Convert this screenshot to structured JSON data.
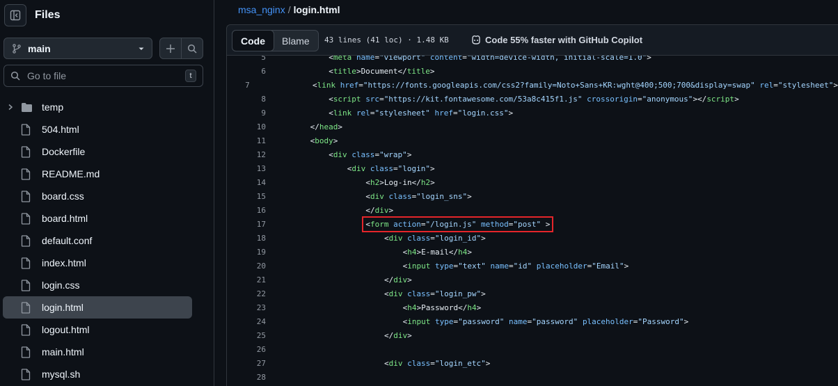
{
  "sidebar": {
    "title": "Files",
    "branch": "main",
    "search_placeholder": "Go to file",
    "search_shortcut": "t",
    "items": [
      {
        "name": "temp",
        "type": "folder"
      },
      {
        "name": "504.html",
        "type": "file"
      },
      {
        "name": "Dockerfile",
        "type": "file"
      },
      {
        "name": "README.md",
        "type": "file"
      },
      {
        "name": "board.css",
        "type": "file"
      },
      {
        "name": "board.html",
        "type": "file"
      },
      {
        "name": "default.conf",
        "type": "file"
      },
      {
        "name": "index.html",
        "type": "file"
      },
      {
        "name": "login.css",
        "type": "file"
      },
      {
        "name": "login.html",
        "type": "file",
        "active": true
      },
      {
        "name": "logout.html",
        "type": "file"
      },
      {
        "name": "main.html",
        "type": "file"
      },
      {
        "name": "mysql.sh",
        "type": "file"
      }
    ]
  },
  "breadcrumb": {
    "repo": "msa_nginx",
    "separator": "/",
    "file": "login.html"
  },
  "file_header": {
    "tab_code": "Code",
    "tab_blame": "Blame",
    "meta": "43 lines (41 loc) · 1.48 KB",
    "copilot": "Code 55% faster with GitHub Copilot"
  },
  "code_lines": [
    {
      "n": "5",
      "indent": 8,
      "tokens": [
        [
          "punc",
          "<"
        ],
        [
          "tag",
          "meta"
        ],
        [
          "punc",
          " "
        ],
        [
          "attr",
          "name"
        ],
        [
          "punc",
          "="
        ],
        [
          "str",
          "\"viewport\""
        ],
        [
          "punc",
          " "
        ],
        [
          "attr",
          "content"
        ],
        [
          "punc",
          "="
        ],
        [
          "str",
          "\"width=device-width, initial-scale=1.0\""
        ],
        [
          "punc",
          ">"
        ]
      ]
    },
    {
      "n": "6",
      "indent": 8,
      "tokens": [
        [
          "punc",
          "<"
        ],
        [
          "tag",
          "title"
        ],
        [
          "punc",
          ">"
        ],
        [
          "text",
          "Document"
        ],
        [
          "punc",
          "</"
        ],
        [
          "tag",
          "title"
        ],
        [
          "punc",
          ">"
        ]
      ]
    },
    {
      "n": "7",
      "indent": 8,
      "tokens": [
        [
          "punc",
          "<"
        ],
        [
          "tag",
          "link"
        ],
        [
          "punc",
          " "
        ],
        [
          "attr",
          "href"
        ],
        [
          "punc",
          "="
        ],
        [
          "str",
          "\"https://fonts.googleapis.com/css2?family=Noto+Sans+KR:wght@400;500;700&display=swap\""
        ],
        [
          "punc",
          " "
        ],
        [
          "attr",
          "rel"
        ],
        [
          "punc",
          "="
        ],
        [
          "str",
          "\"stylesheet\""
        ],
        [
          "punc",
          ">"
        ]
      ]
    },
    {
      "n": "8",
      "indent": 8,
      "tokens": [
        [
          "punc",
          "<"
        ],
        [
          "tag",
          "script"
        ],
        [
          "punc",
          " "
        ],
        [
          "attr",
          "src"
        ],
        [
          "punc",
          "="
        ],
        [
          "str",
          "\"https://kit.fontawesome.com/53a8c415f1.js\""
        ],
        [
          "punc",
          " "
        ],
        [
          "attr",
          "crossorigin"
        ],
        [
          "punc",
          "="
        ],
        [
          "str",
          "\"anonymous\""
        ],
        [
          "punc",
          "></"
        ],
        [
          "tag",
          "script"
        ],
        [
          "punc",
          ">"
        ]
      ]
    },
    {
      "n": "9",
      "indent": 8,
      "tokens": [
        [
          "punc",
          "<"
        ],
        [
          "tag",
          "link"
        ],
        [
          "punc",
          " "
        ],
        [
          "attr",
          "rel"
        ],
        [
          "punc",
          "="
        ],
        [
          "str",
          "\"stylesheet\""
        ],
        [
          "punc",
          " "
        ],
        [
          "attr",
          "href"
        ],
        [
          "punc",
          "="
        ],
        [
          "str",
          "\"login.css\""
        ],
        [
          "punc",
          ">"
        ]
      ]
    },
    {
      "n": "10",
      "indent": 4,
      "tokens": [
        [
          "punc",
          "</"
        ],
        [
          "tag",
          "head"
        ],
        [
          "punc",
          ">"
        ]
      ]
    },
    {
      "n": "11",
      "indent": 4,
      "tokens": [
        [
          "punc",
          "<"
        ],
        [
          "tag",
          "body"
        ],
        [
          "punc",
          ">"
        ]
      ]
    },
    {
      "n": "12",
      "indent": 8,
      "tokens": [
        [
          "punc",
          "<"
        ],
        [
          "tag",
          "div"
        ],
        [
          "punc",
          " "
        ],
        [
          "attr",
          "class"
        ],
        [
          "punc",
          "="
        ],
        [
          "str",
          "\"wrap\""
        ],
        [
          "punc",
          ">"
        ]
      ]
    },
    {
      "n": "13",
      "indent": 12,
      "tokens": [
        [
          "punc",
          "<"
        ],
        [
          "tag",
          "div"
        ],
        [
          "punc",
          " "
        ],
        [
          "attr",
          "class"
        ],
        [
          "punc",
          "="
        ],
        [
          "str",
          "\"login\""
        ],
        [
          "punc",
          ">"
        ]
      ]
    },
    {
      "n": "14",
      "indent": 16,
      "tokens": [
        [
          "punc",
          "<"
        ],
        [
          "tag",
          "h2"
        ],
        [
          "punc",
          ">"
        ],
        [
          "text",
          "Log-in"
        ],
        [
          "punc",
          "</"
        ],
        [
          "tag",
          "h2"
        ],
        [
          "punc",
          ">"
        ]
      ]
    },
    {
      "n": "15",
      "indent": 16,
      "tokens": [
        [
          "punc",
          "<"
        ],
        [
          "tag",
          "div"
        ],
        [
          "punc",
          " "
        ],
        [
          "attr",
          "class"
        ],
        [
          "punc",
          "="
        ],
        [
          "str",
          "\"login_sns\""
        ],
        [
          "punc",
          ">"
        ]
      ]
    },
    {
      "n": "16",
      "indent": 16,
      "tokens": [
        [
          "punc",
          "</"
        ],
        [
          "tag",
          "div"
        ],
        [
          "punc",
          ">"
        ]
      ]
    },
    {
      "n": "17",
      "indent": 16,
      "highlight": true,
      "tokens": [
        [
          "punc",
          "<"
        ],
        [
          "tag",
          "form"
        ],
        [
          "punc",
          " "
        ],
        [
          "attr",
          "action"
        ],
        [
          "punc",
          "="
        ],
        [
          "str",
          "\"/login.js\""
        ],
        [
          "punc",
          " "
        ],
        [
          "attr",
          "method"
        ],
        [
          "punc",
          "="
        ],
        [
          "str",
          "\"post\""
        ],
        [
          "punc",
          " >"
        ]
      ]
    },
    {
      "n": "18",
      "indent": 20,
      "tokens": [
        [
          "punc",
          "<"
        ],
        [
          "tag",
          "div"
        ],
        [
          "punc",
          " "
        ],
        [
          "attr",
          "class"
        ],
        [
          "punc",
          "="
        ],
        [
          "str",
          "\"login_id\""
        ],
        [
          "punc",
          ">"
        ]
      ]
    },
    {
      "n": "19",
      "indent": 24,
      "tokens": [
        [
          "punc",
          "<"
        ],
        [
          "tag",
          "h4"
        ],
        [
          "punc",
          ">"
        ],
        [
          "text",
          "E-mail"
        ],
        [
          "punc",
          "</"
        ],
        [
          "tag",
          "h4"
        ],
        [
          "punc",
          ">"
        ]
      ]
    },
    {
      "n": "20",
      "indent": 24,
      "tokens": [
        [
          "punc",
          "<"
        ],
        [
          "tag",
          "input"
        ],
        [
          "punc",
          " "
        ],
        [
          "attr",
          "type"
        ],
        [
          "punc",
          "="
        ],
        [
          "str",
          "\"text\""
        ],
        [
          "punc",
          " "
        ],
        [
          "attr",
          "name"
        ],
        [
          "punc",
          "="
        ],
        [
          "str",
          "\"id\""
        ],
        [
          "punc",
          " "
        ],
        [
          "attr",
          "placeholder"
        ],
        [
          "punc",
          "="
        ],
        [
          "str",
          "\"Email\""
        ],
        [
          "punc",
          ">"
        ]
      ]
    },
    {
      "n": "21",
      "indent": 20,
      "tokens": [
        [
          "punc",
          "</"
        ],
        [
          "tag",
          "div"
        ],
        [
          "punc",
          ">"
        ]
      ]
    },
    {
      "n": "22",
      "indent": 20,
      "tokens": [
        [
          "punc",
          "<"
        ],
        [
          "tag",
          "div"
        ],
        [
          "punc",
          " "
        ],
        [
          "attr",
          "class"
        ],
        [
          "punc",
          "="
        ],
        [
          "str",
          "\"login_pw\""
        ],
        [
          "punc",
          ">"
        ]
      ]
    },
    {
      "n": "23",
      "indent": 24,
      "tokens": [
        [
          "punc",
          "<"
        ],
        [
          "tag",
          "h4"
        ],
        [
          "punc",
          ">"
        ],
        [
          "text",
          "Password"
        ],
        [
          "punc",
          "</"
        ],
        [
          "tag",
          "h4"
        ],
        [
          "punc",
          ">"
        ]
      ]
    },
    {
      "n": "24",
      "indent": 24,
      "tokens": [
        [
          "punc",
          "<"
        ],
        [
          "tag",
          "input"
        ],
        [
          "punc",
          " "
        ],
        [
          "attr",
          "type"
        ],
        [
          "punc",
          "="
        ],
        [
          "str",
          "\"password\""
        ],
        [
          "punc",
          " "
        ],
        [
          "attr",
          "name"
        ],
        [
          "punc",
          "="
        ],
        [
          "str",
          "\"password\""
        ],
        [
          "punc",
          " "
        ],
        [
          "attr",
          "placeholder"
        ],
        [
          "punc",
          "="
        ],
        [
          "str",
          "\"Password\""
        ],
        [
          "punc",
          ">"
        ]
      ]
    },
    {
      "n": "25",
      "indent": 20,
      "tokens": [
        [
          "punc",
          "</"
        ],
        [
          "tag",
          "div"
        ],
        [
          "punc",
          ">"
        ]
      ]
    },
    {
      "n": "26",
      "indent": 0,
      "tokens": []
    },
    {
      "n": "27",
      "indent": 20,
      "tokens": [
        [
          "punc",
          "<"
        ],
        [
          "tag",
          "div"
        ],
        [
          "punc",
          " "
        ],
        [
          "attr",
          "class"
        ],
        [
          "punc",
          "="
        ],
        [
          "str",
          "\"login_etc\""
        ],
        [
          "punc",
          ">"
        ]
      ]
    },
    {
      "n": "28",
      "indent": 0,
      "tokens": []
    }
  ]
}
